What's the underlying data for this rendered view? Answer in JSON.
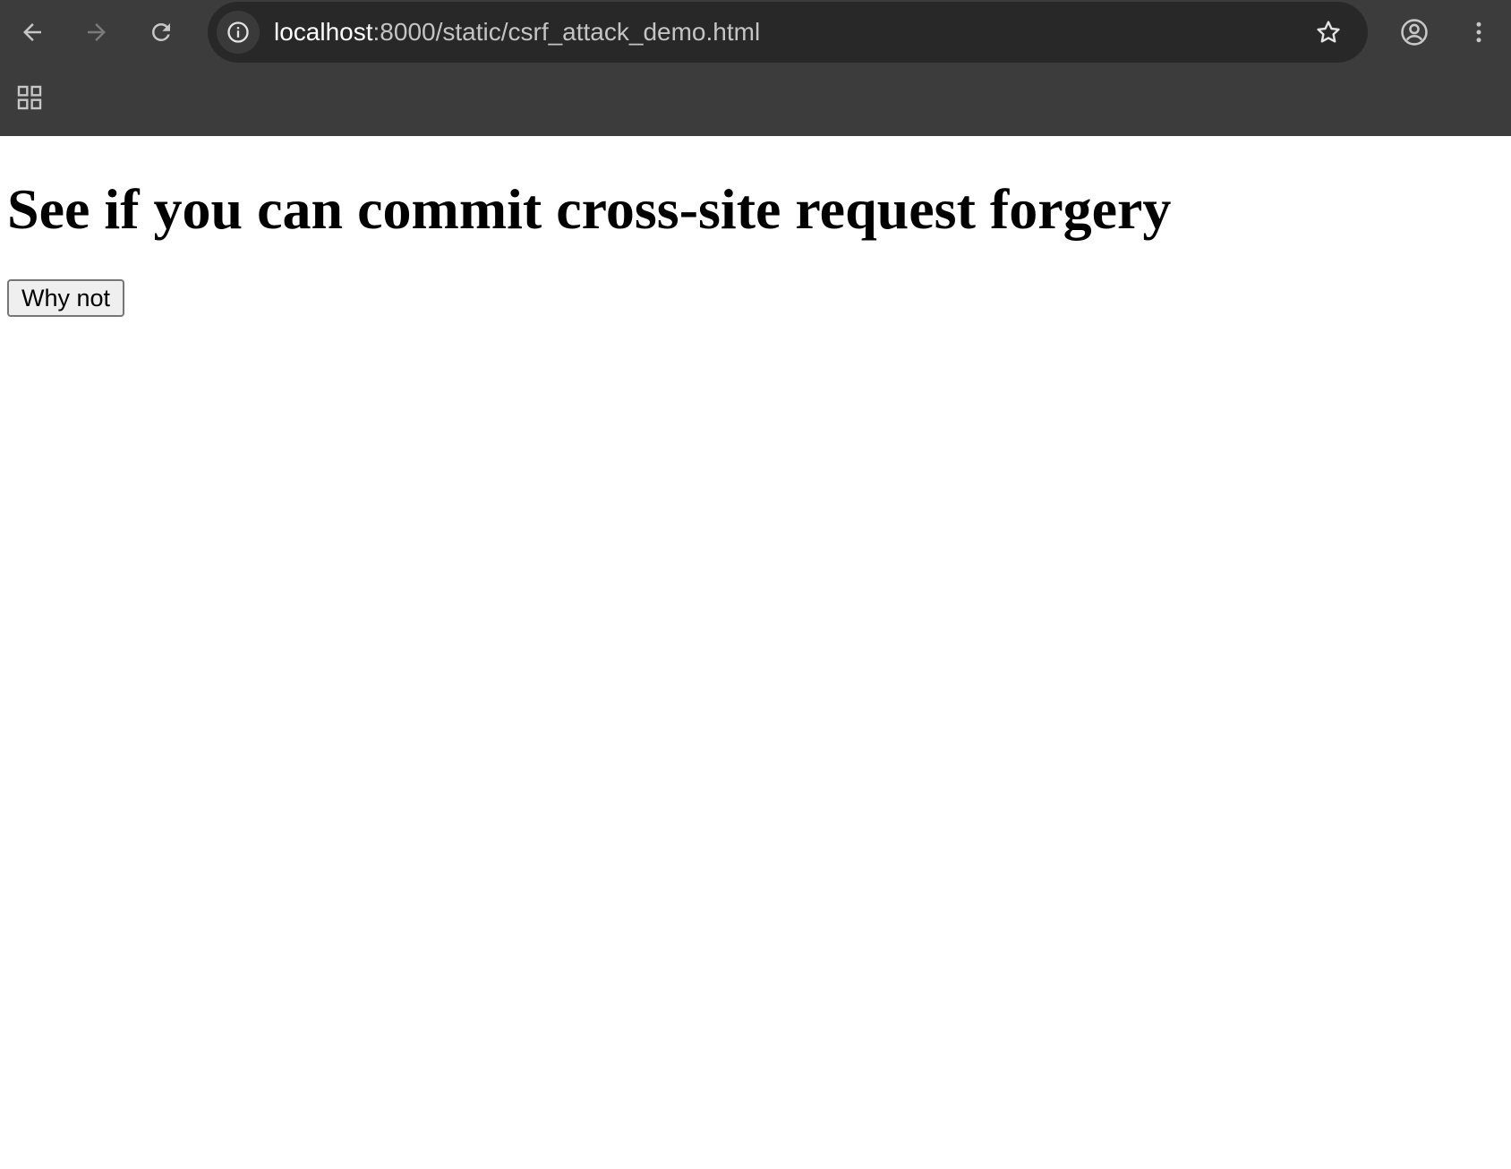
{
  "browser": {
    "url_host": "localhost",
    "url_path": ":8000/static/csrf_attack_demo.html",
    "icons": {
      "back": "arrow-left-icon",
      "forward": "arrow-right-icon",
      "reload": "reload-icon",
      "site_info": "info-icon",
      "bookmark": "star-icon",
      "profile": "account-circle-icon",
      "menu": "kebab-menu-icon",
      "apps": "apps-grid-icon"
    },
    "colors": {
      "chrome_bg": "#3c3c3c",
      "omnibox_bg": "#282828"
    }
  },
  "page": {
    "title": "See if you can commit cross-site request forgery",
    "button_label": "Why not"
  }
}
